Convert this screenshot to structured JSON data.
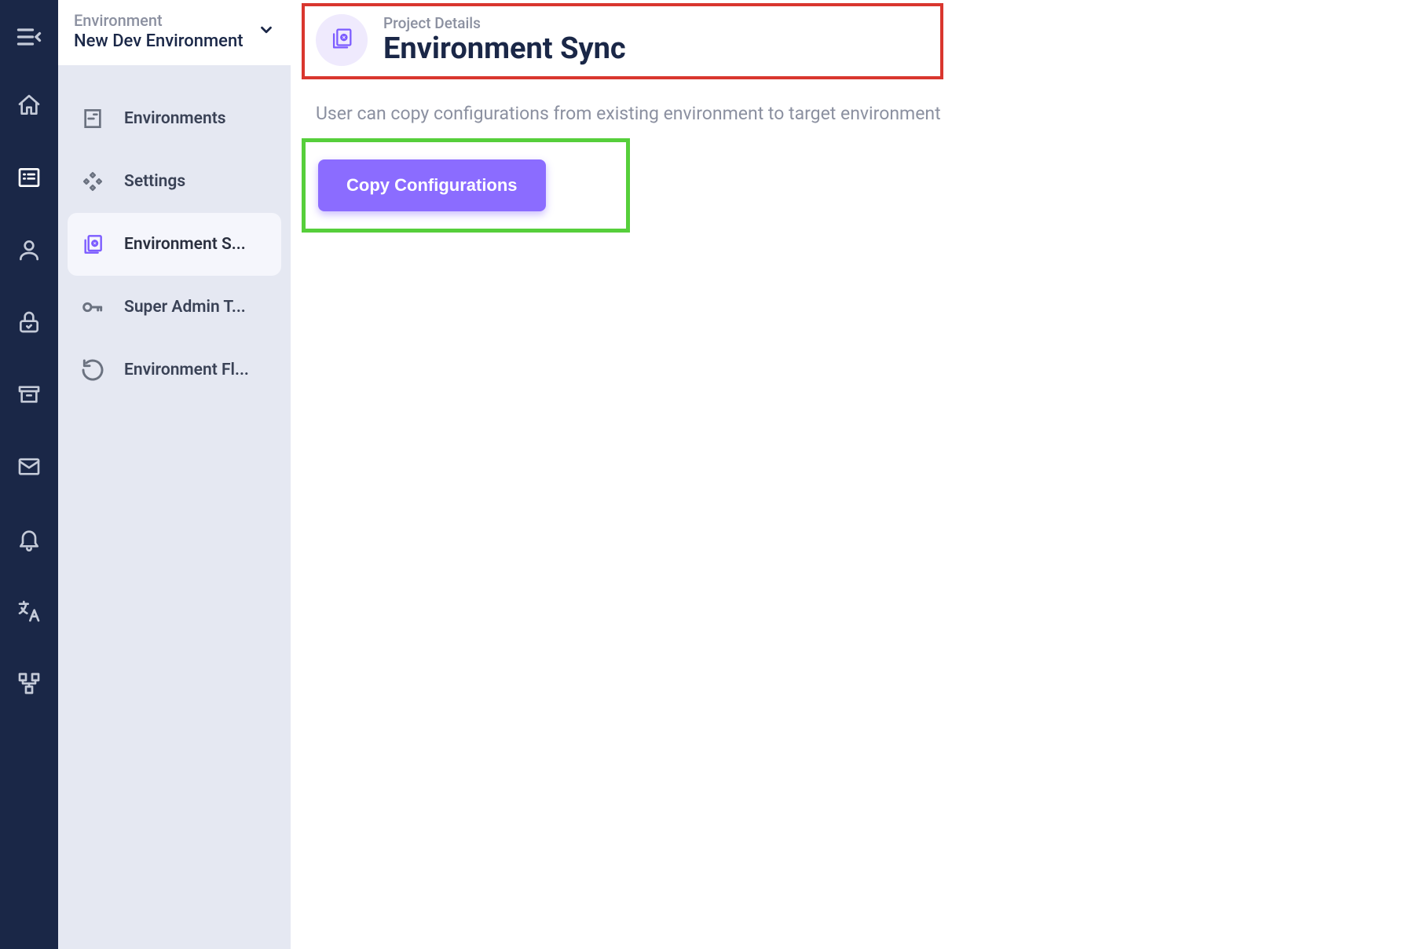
{
  "envSelector": {
    "label": "Environment",
    "name": "New Dev Environment"
  },
  "nav": {
    "items": [
      {
        "label": "Environments"
      },
      {
        "label": "Settings"
      },
      {
        "label": "Environment S..."
      },
      {
        "label": "Super Admin T..."
      },
      {
        "label": "Environment Fl..."
      }
    ]
  },
  "header": {
    "eyebrow": "Project Details",
    "title": "Environment Sync"
  },
  "description": "User can copy configurations from existing environment to target environment",
  "actions": {
    "copyConfigurations": "Copy Configurations"
  },
  "colors": {
    "accentPurple": "#8b6cff",
    "railBg": "#1a2747",
    "highlightRed": "#d9362e",
    "highlightGreen": "#56cf3b"
  }
}
